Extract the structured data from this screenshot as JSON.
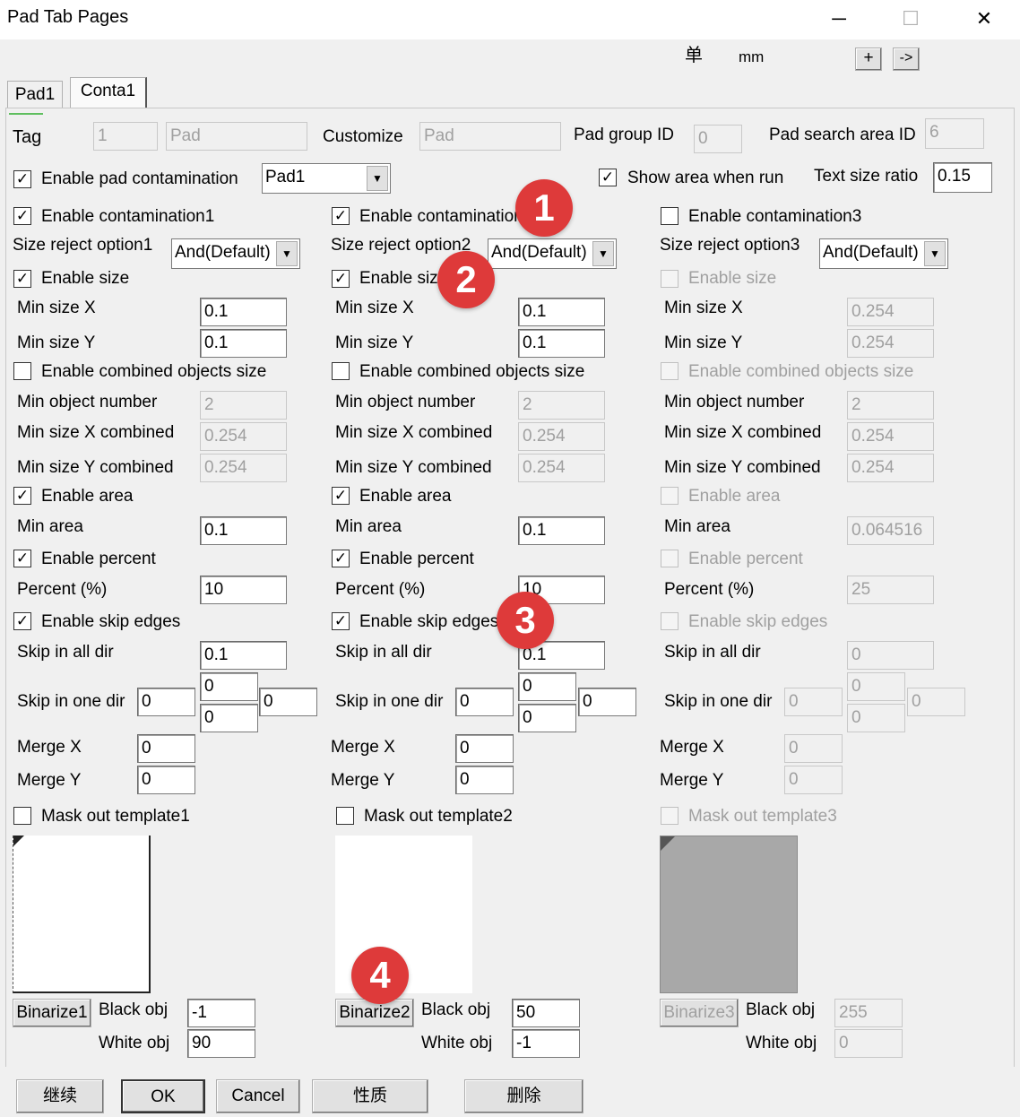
{
  "window": {
    "title": "Pad Tab Pages",
    "minimize": "─",
    "maximize": "☐",
    "close": "✕"
  },
  "header": {
    "unit_char": "单",
    "unit": "mm",
    "plus": "+",
    "arrow": "->"
  },
  "tabs": [
    {
      "label": "Pad1"
    },
    {
      "label": "Conta1"
    }
  ],
  "top": {
    "tag_label": "Tag",
    "tag_value": "1",
    "tag_name": "Pad",
    "customize_label": "Customize",
    "customize_value": "Pad",
    "pad_group_label": "Pad group ID",
    "pad_group_value": "0",
    "pad_search_label": "Pad search area ID",
    "pad_search_value": "6",
    "enable_pad_contamination": "Enable pad contamination",
    "pad_select": "Pad1",
    "show_area": "Show area when run",
    "text_size_ratio_label": "Text size ratio",
    "text_size_ratio": "0.15"
  },
  "columns": [
    {
      "enable": "Enable contamination1",
      "size_reject_label": "Size reject option1",
      "size_reject_value": "And(Default)",
      "enable_size": "Enable size",
      "min_size_x_label": "Min size X",
      "min_size_x": "0.1",
      "min_size_y_label": "Min size Y",
      "min_size_y": "0.1",
      "enable_combined": "Enable combined objects size",
      "min_obj_num_label": "Min object number",
      "min_obj_num": "2",
      "min_x_comb_label": "Min size X combined",
      "min_x_comb": "0.254",
      "min_y_comb_label": "Min size Y combined",
      "min_y_comb": "0.254",
      "enable_area": "Enable area",
      "min_area_label": "Min area",
      "min_area": "0.1",
      "enable_percent": "Enable percent",
      "percent_label": "Percent (%)",
      "percent": "10",
      "enable_skip": "Enable skip edges",
      "skip_all_label": "Skip in all dir",
      "skip_all": "0.1",
      "skip_one_label": "Skip in one dir",
      "skip_one_left": "0",
      "skip_one_top": "0",
      "skip_one_bottom": "0",
      "skip_one_right": "0",
      "merge_x_label": "Merge X",
      "merge_x": "0",
      "merge_y_label": "Merge Y",
      "merge_y": "0",
      "mask_out": "Mask out template1",
      "binarize": "Binarize1",
      "black_obj_label": "Black obj",
      "black_obj": "-1",
      "white_obj_label": "White obj",
      "white_obj": "90"
    },
    {
      "enable": "Enable contamination2",
      "size_reject_label": "Size reject option2",
      "size_reject_value": "And(Default)",
      "enable_size": "Enable size",
      "min_size_x_label": "Min size X",
      "min_size_x": "0.1",
      "min_size_y_label": "Min size Y",
      "min_size_y": "0.1",
      "enable_combined": "Enable combined objects size",
      "min_obj_num_label": "Min object number",
      "min_obj_num": "2",
      "min_x_comb_label": "Min size X combined",
      "min_x_comb": "0.254",
      "min_y_comb_label": "Min size Y combined",
      "min_y_comb": "0.254",
      "enable_area": "Enable area",
      "min_area_label": "Min area",
      "min_area": "0.1",
      "enable_percent": "Enable percent",
      "percent_label": "Percent (%)",
      "percent": "10",
      "enable_skip": "Enable skip edges",
      "skip_all_label": "Skip in all dir",
      "skip_all": "0.1",
      "skip_one_label": "Skip in one dir",
      "skip_one_left": "0",
      "skip_one_top": "0",
      "skip_one_bottom": "0",
      "skip_one_right": "0",
      "merge_x_label": "Merge X",
      "merge_x": "0",
      "merge_y_label": "Merge Y",
      "merge_y": "0",
      "mask_out": "Mask out template2",
      "binarize": "Binarize2",
      "black_obj_label": "Black obj",
      "black_obj": "50",
      "white_obj_label": "White obj",
      "white_obj": "-1"
    },
    {
      "enable": "Enable contamination3",
      "size_reject_label": "Size reject option3",
      "size_reject_value": "And(Default)",
      "enable_size": "Enable size",
      "min_size_x_label": "Min size X",
      "min_size_x": "0.254",
      "min_size_y_label": "Min size Y",
      "min_size_y": "0.254",
      "enable_combined": "Enable combined objects size",
      "min_obj_num_label": "Min object number",
      "min_obj_num": "2",
      "min_x_comb_label": "Min size X combined",
      "min_x_comb": "0.254",
      "min_y_comb_label": "Min size Y combined",
      "min_y_comb": "0.254",
      "enable_area": "Enable area",
      "min_area_label": "Min area",
      "min_area": "0.064516",
      "enable_percent": "Enable percent",
      "percent_label": "Percent (%)",
      "percent": "25",
      "enable_skip": "Enable skip edges",
      "skip_all_label": "Skip in all dir",
      "skip_all": "0",
      "skip_one_label": "Skip in one dir",
      "skip_one_left": "0",
      "skip_one_top": "0",
      "skip_one_bottom": "0",
      "skip_one_right": "0",
      "merge_x_label": "Merge X",
      "merge_x": "0",
      "merge_y_label": "Merge Y",
      "merge_y": "0",
      "mask_out": "Mask out template3",
      "binarize": "Binarize3",
      "black_obj_label": "Black obj",
      "black_obj": "255",
      "white_obj_label": "White obj",
      "white_obj": "0"
    }
  ],
  "checks": {
    "checked": "✓"
  },
  "badges": [
    "1",
    "2",
    "3",
    "4"
  ],
  "bottom": {
    "continue": "继续",
    "ok": "OK",
    "cancel": "Cancel",
    "properties": "性质",
    "delete": "删除"
  },
  "colors": {
    "badge": "#de3a3a",
    "disabled_text": "#a0a0a0",
    "window_bg": "#f0f0f0"
  }
}
